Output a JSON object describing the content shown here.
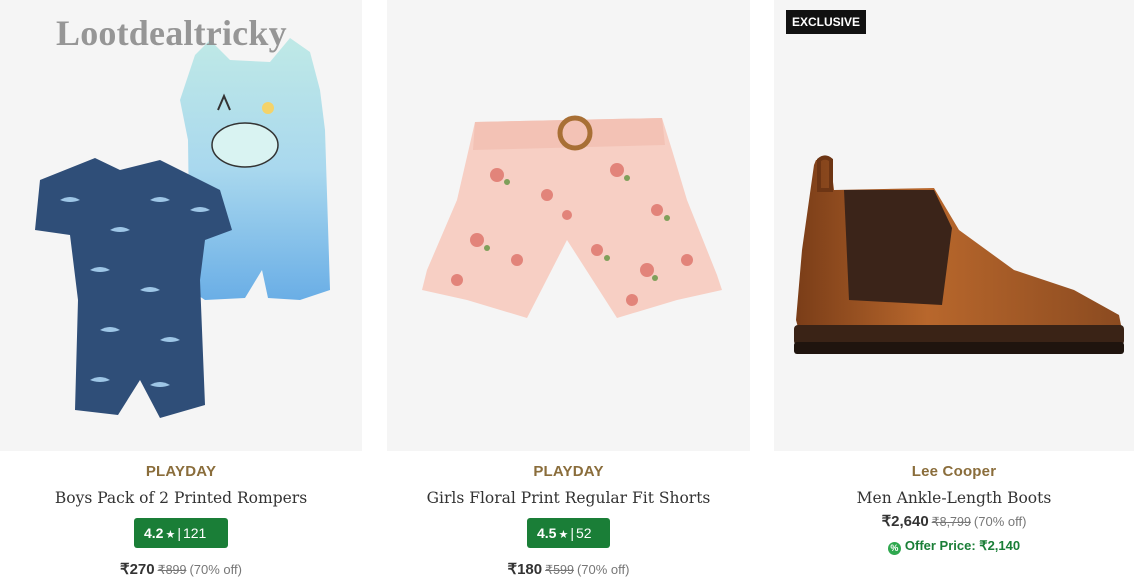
{
  "watermark": "Lootdealtricky",
  "colors": {
    "brand_text": "#8a6d3b",
    "rating_badge": "#1a7e37",
    "offer_text": "#1a7e37",
    "image_background": "#f5f5f5"
  },
  "products": [
    {
      "image": "baby-rompers-pack-image",
      "brand": "PLAYDAY",
      "title": "Boys Pack of 2 Printed Rompers",
      "rating": "4.2",
      "rating_icon": "star-icon",
      "rating_separator": "|",
      "rating_count": "121",
      "price": "₹270",
      "mrp": "₹899",
      "discount": "(70% off)"
    },
    {
      "image": "floral-shorts-image",
      "brand": "PLAYDAY",
      "title": "Girls Floral Print Regular Fit Shorts",
      "rating": "4.5",
      "rating_icon": "star-icon",
      "rating_separator": "|",
      "rating_count": "52",
      "price": "₹180",
      "mrp": "₹599",
      "discount": "(70% off)"
    },
    {
      "image": "ankle-boot-image",
      "badge": "EXCLUSIVE",
      "brand": "Lee Cooper",
      "title": "Men Ankle-Length Boots",
      "price": "₹2,640",
      "mrp": "₹8,799",
      "discount": "(70% off)",
      "offer_icon": "offer-tag-icon",
      "offer_label": "Offer Price: ₹2,140"
    }
  ]
}
